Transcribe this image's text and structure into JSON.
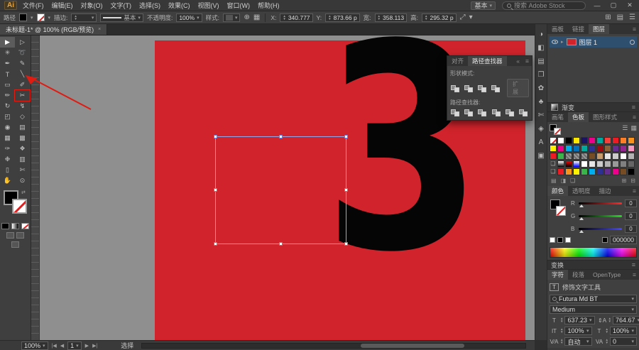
{
  "app": {
    "logo": "Ai",
    "menus": [
      "文件(F)",
      "编辑(E)",
      "对象(O)",
      "文字(T)",
      "选择(S)",
      "效果(C)",
      "视图(V)",
      "窗口(W)",
      "帮助(H)"
    ],
    "workspace": "基本",
    "search_placeholder": "搜索 Adobe Stock",
    "minimize": "—",
    "maximize": "▢",
    "close": "✕"
  },
  "controlbar": {
    "object": "路径",
    "stroke_label": "描边:",
    "profile": "基本",
    "opacity_label": "不透明度:",
    "opacity": "100%",
    "style_label": "样式:",
    "x_label": "X:",
    "x": "340.777",
    "y_label": "Y:",
    "y": "873.66 p",
    "w_label": "宽:",
    "w": "358.113",
    "h_label": "高:",
    "h": "295.32 p"
  },
  "doc_tab": {
    "title": "未标题-1* @ 100% (RGB/预览)",
    "close": "×"
  },
  "tools": [
    {
      "l": "▶",
      "ln": "selection-tool",
      "r": "▷",
      "rn": "direct-selection-tool"
    },
    {
      "l": "✳",
      "ln": "magic-wand-tool",
      "r": "➰",
      "rn": "lasso-tool"
    },
    {
      "l": "✒",
      "ln": "pen-tool",
      "r": "✎",
      "rn": "anchor-point-tool"
    },
    {
      "l": "T",
      "ln": "type-tool",
      "r": "╲",
      "rn": "line-segment-tool"
    },
    {
      "l": "▭",
      "ln": "rectangle-tool",
      "r": "✐",
      "rn": "paintbrush-tool"
    },
    {
      "l": "✏",
      "ln": "pencil-tool",
      "r": "✂",
      "rn": "scissors-tool"
    },
    {
      "l": "↻",
      "ln": "rotate-tool",
      "r": "↯",
      "rn": "width-tool"
    },
    {
      "l": "◰",
      "ln": "scale-tool",
      "r": "◇",
      "rn": "free-transform-tool"
    },
    {
      "l": "◉",
      "ln": "shape-builder-tool",
      "r": "▤",
      "rn": "perspective-grid-tool"
    },
    {
      "l": "▦",
      "ln": "mesh-tool",
      "r": "▩",
      "rn": "gradient-tool"
    },
    {
      "l": "✑",
      "ln": "eyedropper-tool",
      "r": "❖",
      "rn": "blend-tool"
    },
    {
      "l": "❉",
      "ln": "symbol-sprayer-tool",
      "r": "▥",
      "rn": "column-graph-tool"
    },
    {
      "l": "▯",
      "ln": "artboard-tool",
      "r": "✄",
      "rn": "slice-tool"
    },
    {
      "l": "✋",
      "ln": "hand-tool",
      "r": "⊙",
      "rn": "zoom-tool"
    }
  ],
  "dock": [
    {
      "g": "◑",
      "n": "color-panel-icon"
    },
    {
      "g": "◧",
      "n": "gradient-panel-icon"
    },
    {
      "g": "▤",
      "n": "appearance-panel-icon"
    },
    {
      "g": "❐",
      "n": "artboards-panel-icon"
    },
    {
      "g": "✿",
      "n": "brushes-panel-icon"
    },
    {
      "g": "♣",
      "n": "symbols-panel-icon"
    },
    {
      "g": "✄",
      "n": "pathfinder-panel-icon"
    },
    {
      "g": "◈",
      "n": "stroke-panel-icon"
    },
    {
      "g": "A",
      "n": "glyphs-panel-icon"
    },
    {
      "g": "▣",
      "n": "libraries-panel-icon"
    }
  ],
  "pathfinder": {
    "tabs": [
      "对齐",
      "路径查找器"
    ],
    "collapse_icon": "«",
    "menu_icon": "≡",
    "shape_modes_label": "形状模式:",
    "expand_label": "扩展",
    "pathfinders_label": "路径查找器:",
    "shape_mode_count": 4,
    "pathfinder_count": 6
  },
  "layers": {
    "tabs": [
      "画板",
      "链接",
      "图层"
    ],
    "layer_name": "图层 1",
    "expand_icon": "▸"
  },
  "gradient_panel": {
    "label": "渐变"
  },
  "swatches": {
    "tabs": [
      "画笔",
      "色板",
      "图形样式"
    ],
    "list_icon": "☰",
    "grid_icon": "▦",
    "foot_icons": [
      "▤",
      "◨",
      "❑"
    ],
    "foot_icons_right": [
      "⊞",
      "⊟"
    ],
    "rows": [
      [
        "none",
        "#ffffff",
        "#000000",
        "#ffe800",
        "#1b1464",
        "#ec008c",
        "#00a99d",
        "#f7403a",
        "#ed1c24",
        "#ff7f27",
        "#f7941d"
      ],
      [
        "#fff200",
        "#ec008c",
        "#00aeef",
        "#0072bc",
        "#00a99d",
        "#2e3192",
        "#9e0b0f",
        "#8c6239",
        "#662d91",
        "#92278f",
        "#f49ac1"
      ],
      [
        "#ed1c24",
        "#39b54a",
        "pattern",
        "pattern",
        "pattern",
        "#754c24",
        "#c69c6d",
        "#e6e6e6",
        "#cccccc",
        "#ffffff",
        "#b3b3b3"
      ],
      [
        "folder",
        "grad:#ffffff,#000000",
        "grad:#ff0000,#000000",
        "grad:#ffffff,#0000ff",
        "#ffffff",
        "#e6e6e6",
        "#cccccc",
        "#b3b3b3",
        "#999999",
        "#808080",
        "#666666"
      ],
      [
        "folder",
        "#ed1c24",
        "#f7941d",
        "#fff200",
        "#39b54a",
        "#00aeef",
        "#2e3192",
        "#662d91",
        "#ec008c",
        "#754c24",
        "#000000"
      ]
    ]
  },
  "color": {
    "tabs": [
      "颜色",
      "透明度",
      "描边"
    ],
    "channels": [
      {
        "label": "R",
        "value": "0",
        "color": "#ff2a2a"
      },
      {
        "label": "G",
        "value": "0",
        "color": "#2ad52a"
      },
      {
        "label": "B",
        "value": "0",
        "color": "#4646ff"
      }
    ],
    "hex": "000000"
  },
  "transform_panel": {
    "label": "变换"
  },
  "character": {
    "tabs": [
      "字符",
      "段落",
      "OpenType"
    ],
    "touch_tool": "修饰文字工具",
    "touch_icon": "T",
    "font": "Futura Md BT",
    "style": "Medium",
    "size_icon": "T",
    "size": "637.23",
    "leading_icon": "⇕A",
    "leading": "764.67",
    "vscale_icon": "ΙT",
    "vscale": "100%",
    "hscale_icon": "T",
    "hscale": "100%",
    "kern_icon": "V⁄A",
    "kerning": "自动",
    "track_icon": "VA",
    "tracking": "0"
  },
  "canvas": {
    "glyph": "3"
  },
  "statusbar": {
    "zoom": "100%",
    "nav_icons": [
      "|◀",
      "◀",
      "▶",
      "▶|"
    ],
    "artboard": "1",
    "tool": "选择"
  },
  "colors": {
    "artboard": "#d0232b",
    "selection": "#5f7de8",
    "annotation": "#e01b12"
  }
}
